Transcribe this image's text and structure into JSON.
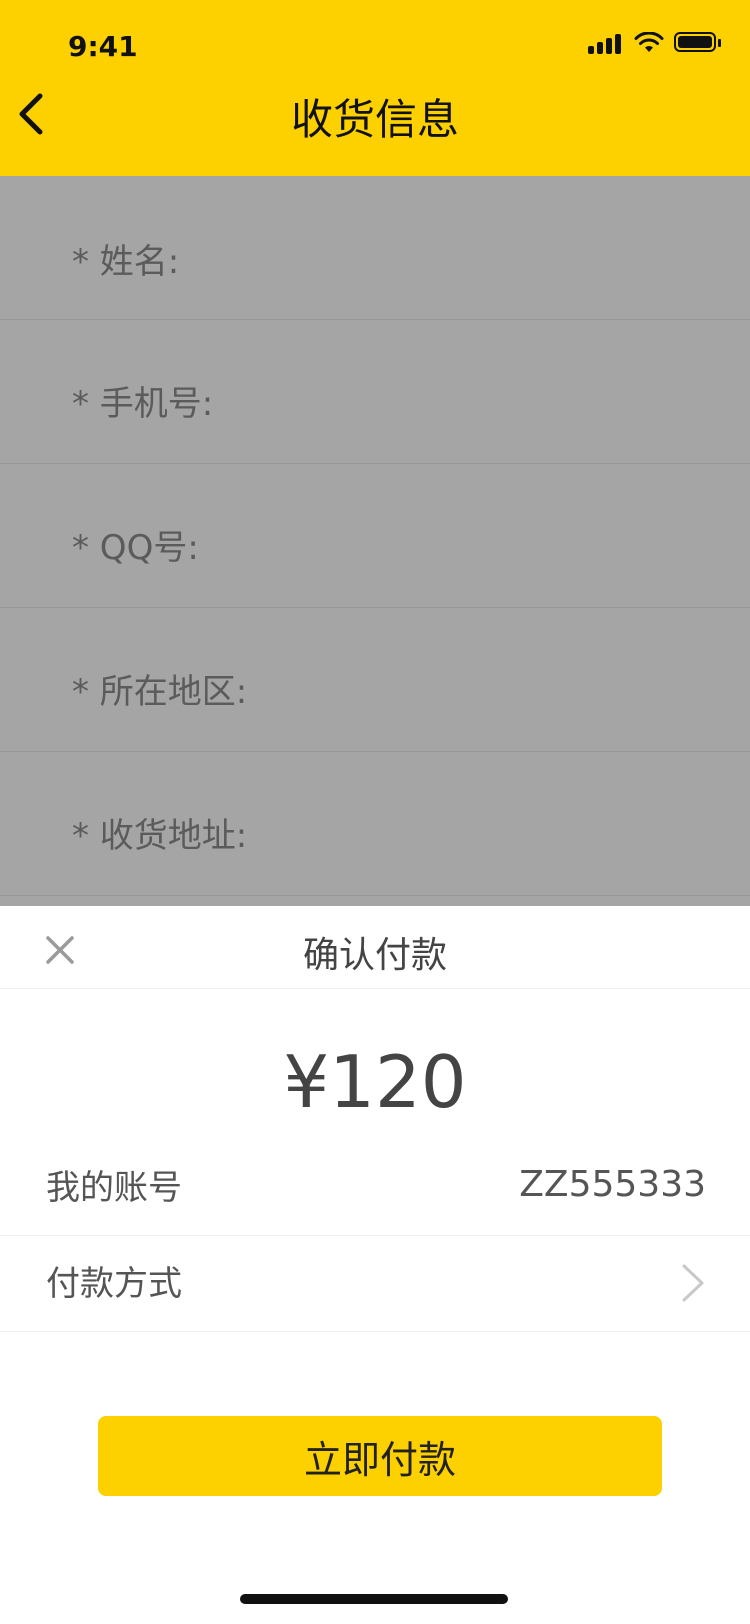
{
  "status_bar": {
    "time": "9:41"
  },
  "header": {
    "title": "收货信息"
  },
  "form": {
    "fields": [
      {
        "label": "* 姓名:"
      },
      {
        "label": "* 手机号:"
      },
      {
        "label": "* QQ号:"
      },
      {
        "label": "* 所在地区:"
      },
      {
        "label": "* 收货地址:"
      }
    ]
  },
  "payment_sheet": {
    "title": "确认付款",
    "amount": "¥120",
    "account_label": "我的账号",
    "account_value": "ZZ555333",
    "method_label": "付款方式",
    "pay_button_label": "立即付款"
  },
  "colors": {
    "accent": "#FDD000",
    "overlay_bg": "#A5A5A5"
  },
  "icons": [
    "back-arrow-icon",
    "signal-icon",
    "wifi-icon",
    "battery-icon",
    "close-icon",
    "chevron-right-icon"
  ]
}
